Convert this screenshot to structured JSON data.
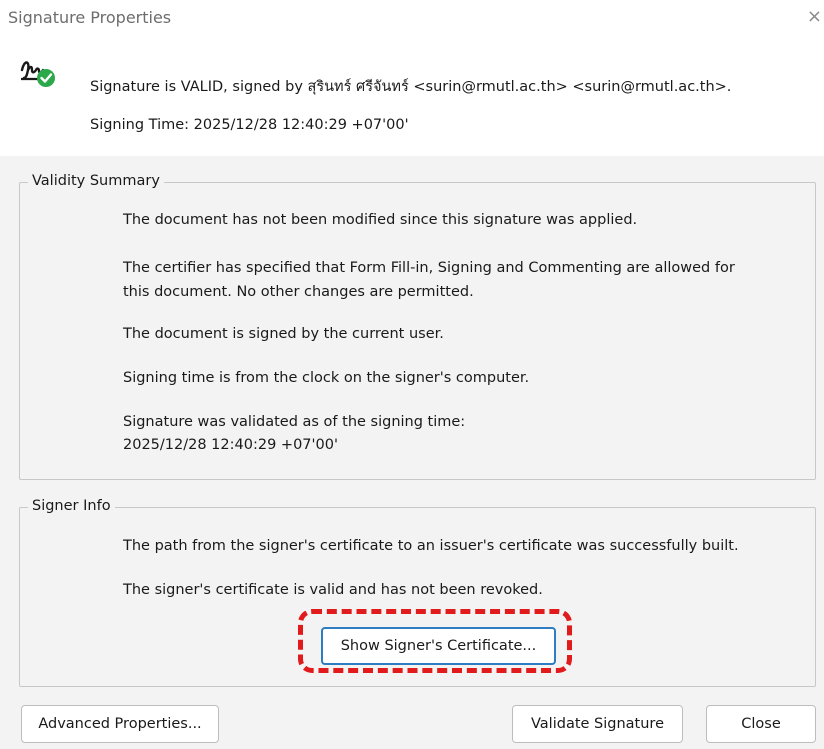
{
  "window": {
    "title": "Signature Properties",
    "close_glyph": "×"
  },
  "header": {
    "icon": "signature-valid-icon",
    "status_line": "Signature is VALID, signed by สุรินทร์ ศรีจันทร์ <surin@rmutl.ac.th> <surin@rmutl.ac.th>.",
    "signing_time": "Signing Time:  2025/12/28 12:40:29 +07'00'"
  },
  "validity_summary": {
    "legend": "Validity Summary",
    "lines": [
      "The document has not been modified since this signature was applied.",
      "The certifier has specified that Form Fill-in, Signing and Commenting are allowed for",
      "this document. No other changes are permitted.",
      "The document is signed by the current user.",
      "Signing time is from the clock on the signer's computer.",
      "Signature was validated as of the signing time:",
      "2025/12/28 12:40:29 +07'00'"
    ]
  },
  "signer_info": {
    "legend": "Signer Info",
    "lines": [
      "The path from the signer's certificate to an issuer's certificate was successfully built.",
      "The signer's certificate is valid and has not been revoked."
    ],
    "show_cert_button": "Show Signer's Certificate..."
  },
  "footer": {
    "advanced_button": "Advanced Properties...",
    "validate_button": "Validate Signature",
    "close_button": "Close"
  },
  "colors": {
    "highlight": "#e11b1b",
    "focus_border": "#2e7cc2",
    "valid_badge": "#2aa84a"
  }
}
